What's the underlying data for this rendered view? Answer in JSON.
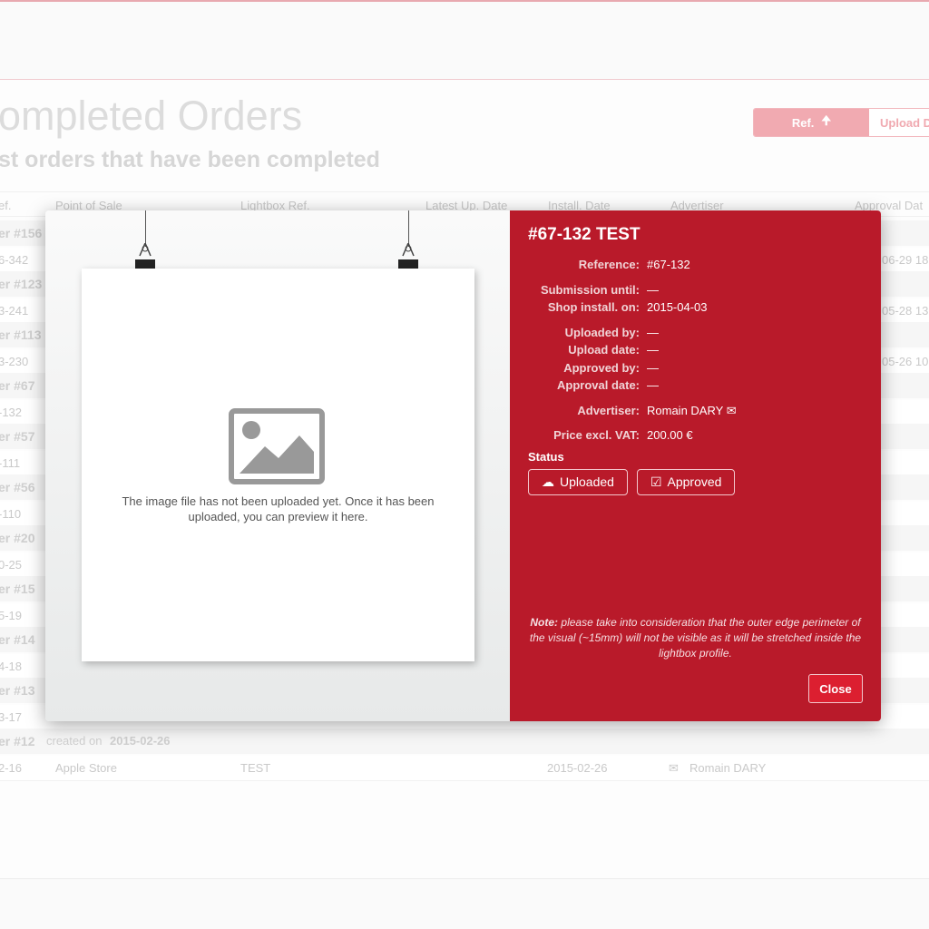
{
  "page": {
    "title": "ompleted Orders",
    "subtitle": "st orders that have been completed"
  },
  "sort": {
    "active": "Ref.",
    "next": "Upload D"
  },
  "table": {
    "headers": [
      "ef.",
      "Point of Sale",
      "Lightbox Ref.",
      "Latest Up. Date",
      "Install. Date",
      "Advertiser",
      "Approval Dat"
    ],
    "groups": [
      "er #156",
      "er #123",
      "er #113",
      "er #67",
      "er #57",
      "er #56",
      "er #20",
      "er #15",
      "er #14",
      "er #13",
      "er #12"
    ],
    "items": [
      "6-342",
      "3-241",
      "3-230",
      "-132",
      "-111",
      "-110",
      "0-25",
      "5-19",
      "4-18",
      "3-17",
      "2-16"
    ],
    "approval_dates": [
      "06-29 18",
      "05-28 13",
      "05-26 10"
    ],
    "last_group_created": "created on",
    "last_group_date": "2015-02-26",
    "last_row": {
      "point_of_sale": "Apple Store",
      "lightbox_ref": "TEST",
      "install_date": "2015-02-26",
      "advertiser": "Romain DARY"
    }
  },
  "modal": {
    "title": "#67-132 TEST",
    "placeholder_text": "The image file has not been uploaded yet. Once it has been uploaded, you can preview it here.",
    "fields": [
      {
        "label": "Reference:",
        "value": "#67-132"
      },
      {
        "label": "Submission until:",
        "value": "—"
      },
      {
        "label": "Shop install. on:",
        "value": "2015-04-03"
      },
      {
        "label": "Uploaded by:",
        "value": "—"
      },
      {
        "label": "Upload date:",
        "value": "—"
      },
      {
        "label": "Approved by:",
        "value": "—"
      },
      {
        "label": "Approval date:",
        "value": "—"
      },
      {
        "label": "Advertiser:",
        "value": "Romain DARY"
      },
      {
        "label": "Price excl. VAT:",
        "value": "200.00 €"
      }
    ],
    "status_label": "Status",
    "uploaded_label": "Uploaded",
    "approved_label": "Approved",
    "note_bold": "Note:",
    "note_text": " please take into consideration that the outer edge perimeter of the visual (~15mm) will not be visible as it will be stretched inside the lightbox profile.",
    "close_label": "Close"
  },
  "colors": {
    "accent": "#b91a2a",
    "close_button": "#dc1f30"
  }
}
